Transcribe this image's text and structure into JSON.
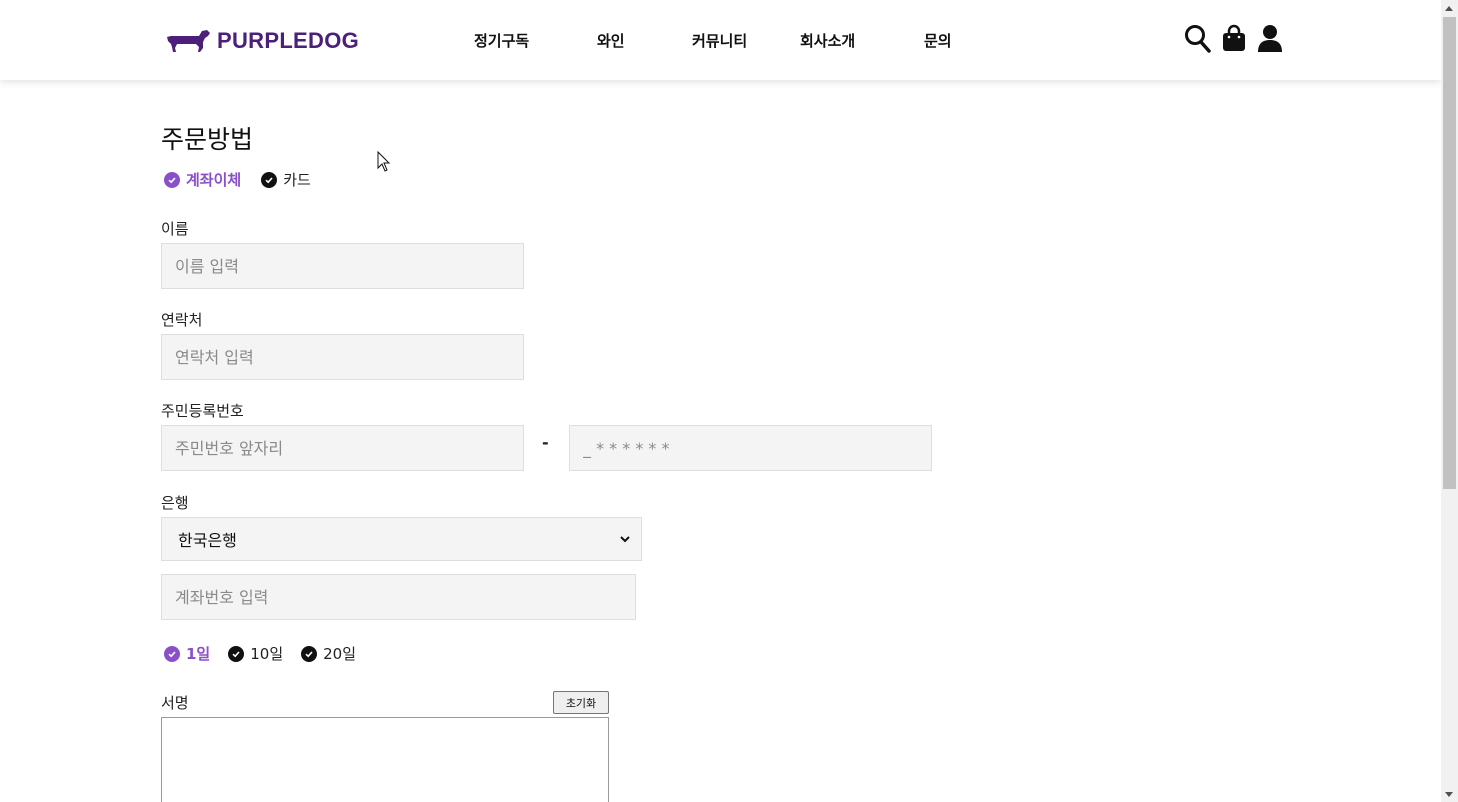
{
  "header": {
    "logo_text": "PURPLEDOG",
    "nav": [
      "정기구독",
      "와인",
      "커뮤니티",
      "회사소개",
      "문의"
    ],
    "icons": [
      "search-icon",
      "shopping-bag-icon",
      "user-icon"
    ]
  },
  "main": {
    "title": "주문방법",
    "payment_methods": [
      {
        "label": "계좌이체",
        "selected": true
      },
      {
        "label": "카드",
        "selected": false
      }
    ],
    "name": {
      "label": "이름",
      "placeholder": "이름 입력"
    },
    "phone": {
      "label": "연락처",
      "placeholder": "연락처 입력"
    },
    "rrn": {
      "label": "주민등록번호",
      "front_placeholder": "주민번호 앞자리",
      "back_placeholder": "_ * * * * * *",
      "separator": "-"
    },
    "bank": {
      "label": "은행",
      "selected": "한국은행",
      "account_placeholder": "계좌번호 입력"
    },
    "pay_days": [
      {
        "label": "1일",
        "selected": true
      },
      {
        "label": "10일",
        "selected": false
      },
      {
        "label": "20일",
        "selected": false
      }
    ],
    "signature": {
      "label": "서명",
      "reset_label": "초기화"
    }
  },
  "colors": {
    "accent": "#8a4fc9",
    "brand": "#4b1f7a",
    "input_bg": "#f4f4f4"
  }
}
